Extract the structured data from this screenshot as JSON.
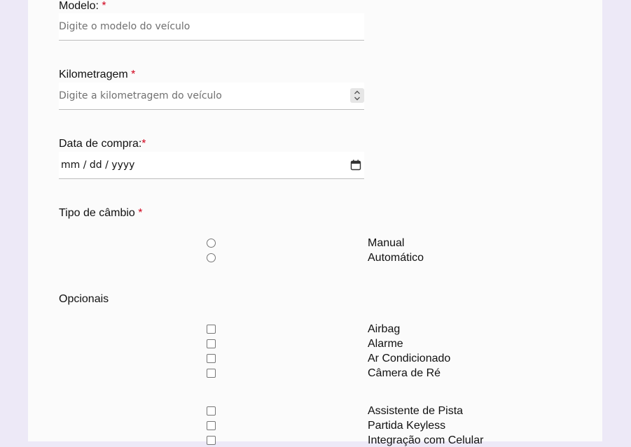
{
  "form": {
    "modelo": {
      "label": "Modelo: ",
      "required": "*",
      "placeholder": "Digite o modelo do veículo"
    },
    "km": {
      "label": "Kilometragem ",
      "required": "*",
      "placeholder": "Digite a kilometragem do veículo"
    },
    "data": {
      "label": "Data de compra:",
      "required": "*",
      "value": "mm / dd / yyyy"
    },
    "cambio": {
      "label": "Tipo de câmbio ",
      "required": "*",
      "options": [
        "Manual",
        "Automático"
      ]
    },
    "opcionais": {
      "label": "Opcionais",
      "group1": [
        "Airbag",
        "Alarme",
        "Ar Condicionado",
        "Câmera de Ré"
      ],
      "group2": [
        "Assistente de Pista",
        "Partida Keyless",
        "Integração com Celular"
      ]
    }
  },
  "icons": {
    "spinner": "number-spinner-icon",
    "calendar": "calendar-icon"
  },
  "colors": {
    "background": "#ede9f7",
    "card": "#fbfbfb",
    "required": "#d0021b"
  }
}
